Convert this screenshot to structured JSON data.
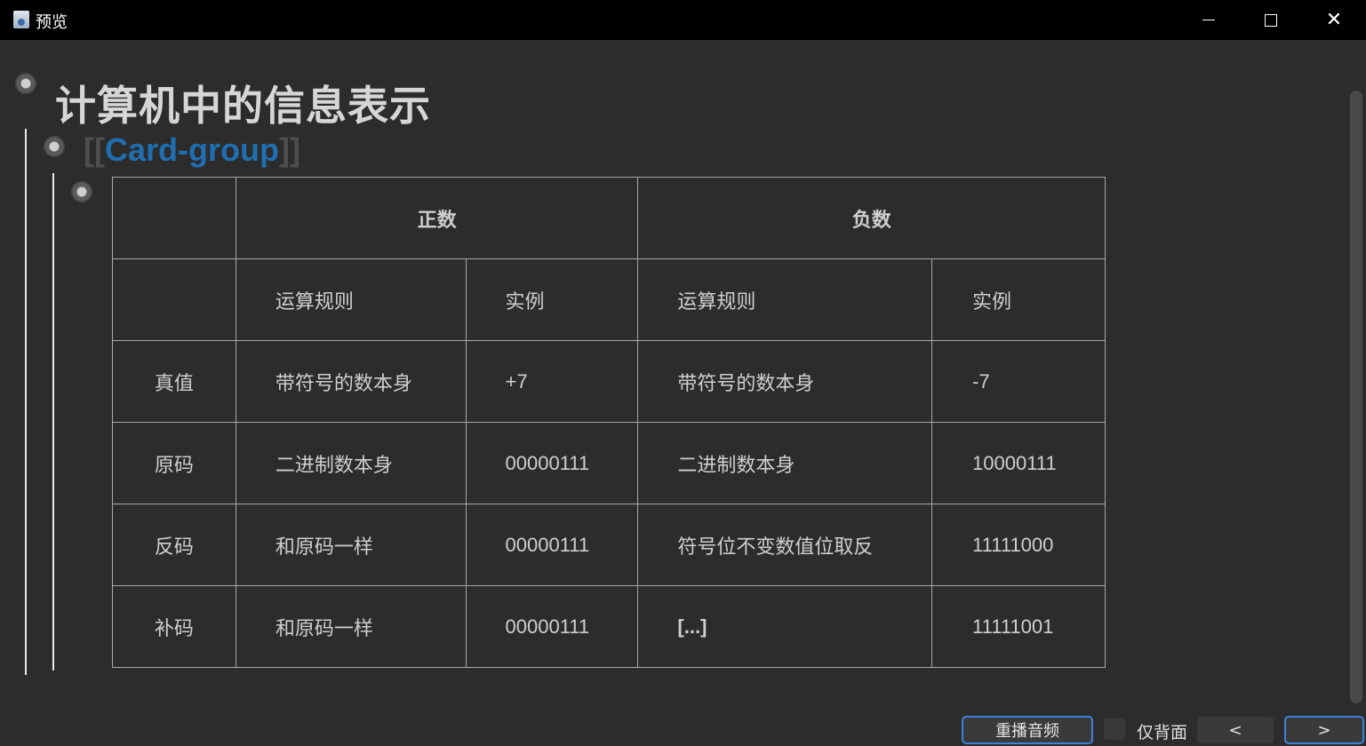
{
  "window": {
    "title": "预览",
    "controls": {
      "minimize": "minimize",
      "maximize": "maximize",
      "close": "✕"
    }
  },
  "note": {
    "title": "计算机中的信息表示",
    "card_link": {
      "open": "[[",
      "text": "Card-group",
      "close": "]]"
    }
  },
  "table": {
    "header_top": [
      "",
      "正数",
      "负数"
    ],
    "header_sub": [
      "",
      "运算规则",
      "实例",
      "运算规则",
      "实例"
    ],
    "rows": [
      [
        "真值",
        "带符号的数本身",
        "+7",
        "带符号的数本身",
        "-7"
      ],
      [
        "原码",
        "二进制数本身",
        "00000111",
        "二进制数本身",
        "10000111"
      ],
      [
        "反码",
        "和原码一样",
        "00000111",
        "符号位不变数值位取反",
        "11111000"
      ],
      [
        "补码",
        "和原码一样",
        "00000111",
        "[...]",
        "11111001"
      ]
    ]
  },
  "bottombar": {
    "replay_label": "重播音频",
    "back_only_label": "仅背面",
    "prev_label": "<",
    "next_label": ">"
  },
  "colors": {
    "background": "#2c2c2c",
    "titlebar": "#000000",
    "link": "#1f6fb0",
    "cloze": "#9fd0ea",
    "accent_border": "#3d82d9"
  }
}
